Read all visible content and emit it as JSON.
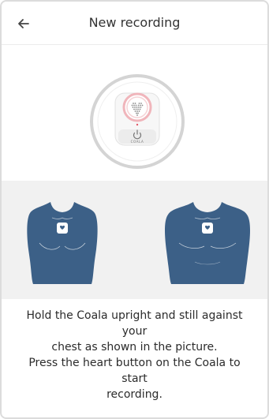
{
  "header": {
    "title": "New recording",
    "back_icon": "arrow-left-icon"
  },
  "device": {
    "brand": "COALA",
    "heart_icon": "heart-icon",
    "power_icon": "power-icon"
  },
  "illustration": {
    "torso_icon": "torso-icon",
    "placement_icon": "device-placement-icon"
  },
  "instructions": {
    "line1": "Hold the Coala upright and still against your",
    "line2": "chest as shown in the picture.",
    "line3": "Press the heart button on the Coala to start",
    "line4": "recording."
  },
  "colors": {
    "torso": "#3c6087",
    "ring": "#cfcfcf",
    "heart_accent": "#e8a5ad",
    "panel_bg": "#f1f1f1"
  }
}
